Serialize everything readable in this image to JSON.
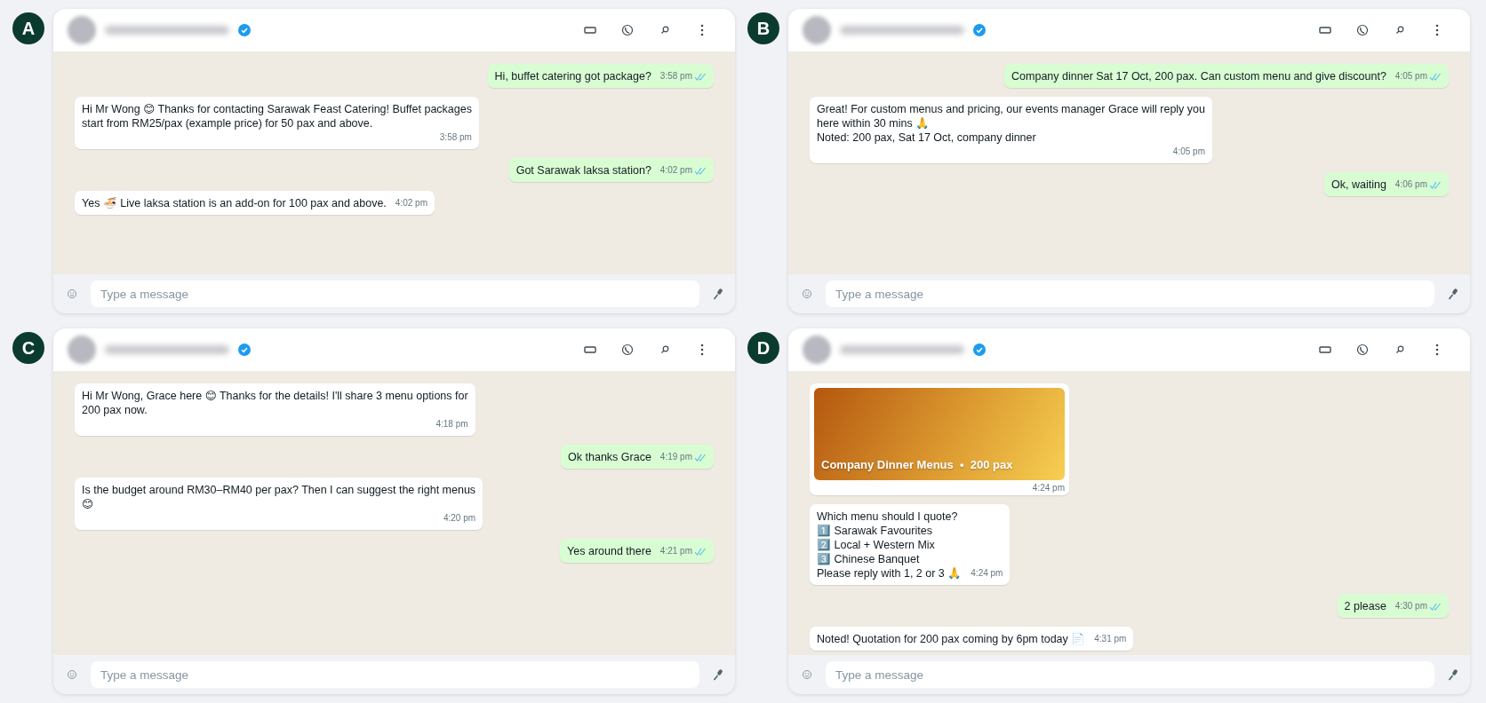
{
  "panels": [
    {
      "label": "A",
      "placeholder": "Type a message",
      "messages": [
        {
          "kind": "out",
          "text": "Hi, buffet catering got package?",
          "time": "3:58 pm"
        },
        {
          "kind": "in",
          "text": "Hi Mr Wong 😊 Thanks for contacting Sarawak Feast Catering! Buffet packages\nstart from RM25/pax (example price) for 50 pax and above.",
          "time": "3:58 pm"
        },
        {
          "kind": "out",
          "text": "Got Sarawak laksa station?",
          "time": "4:02 pm"
        },
        {
          "kind": "in",
          "text": "Yes 🍜 Live laksa station is an add-on for 100 pax and above.",
          "time": "4:02 pm"
        }
      ]
    },
    {
      "label": "B",
      "placeholder": "Type a message",
      "messages": [
        {
          "kind": "out",
          "text": "Company dinner Sat 17 Oct, 200 pax. Can custom menu and give discount?",
          "time": "4:05 pm"
        },
        {
          "kind": "in",
          "text": "Great! For custom menus and pricing, our events manager Grace will reply you\nhere within 30 mins 🙏\nNoted: 200 pax, Sat 17 Oct, company dinner",
          "time": "4:05 pm"
        },
        {
          "kind": "out",
          "text": "Ok, waiting",
          "time": "4:06 pm"
        }
      ]
    },
    {
      "label": "C",
      "placeholder": "Type a message",
      "messages": [
        {
          "kind": "in",
          "text": "Hi Mr Wong, Grace here 😊 Thanks for the details! I'll share 3 menu options for\n200 pax now.",
          "time": "4:18 pm"
        },
        {
          "kind": "out",
          "text": "Ok thanks Grace",
          "time": "4:19 pm"
        },
        {
          "kind": "in",
          "text": "Is the budget around RM30–RM40 per pax? Then I can suggest the right menus\n😊",
          "time": "4:20 pm"
        },
        {
          "kind": "out",
          "text": "Yes around there",
          "time": "4:21 pm"
        }
      ]
    },
    {
      "label": "D",
      "placeholder": "Type a message",
      "messages": [
        {
          "kind": "image",
          "text": "Company Dinner Menus  •  200 pax",
          "time": "4:24 pm"
        },
        {
          "kind": "in",
          "text": "Which menu should I quote?\n1️⃣ Sarawak Favourites\n2️⃣ Local + Western Mix\n3️⃣ Chinese Banquet\nPlease reply with 1, 2 or 3 🙏",
          "time": "4:24 pm"
        },
        {
          "kind": "out",
          "text": "2 please",
          "time": "4:30 pm"
        },
        {
          "kind": "in",
          "text": "Noted! Quotation for 200 pax coming by 6pm today 📄",
          "time": "4:31 pm"
        }
      ]
    }
  ]
}
